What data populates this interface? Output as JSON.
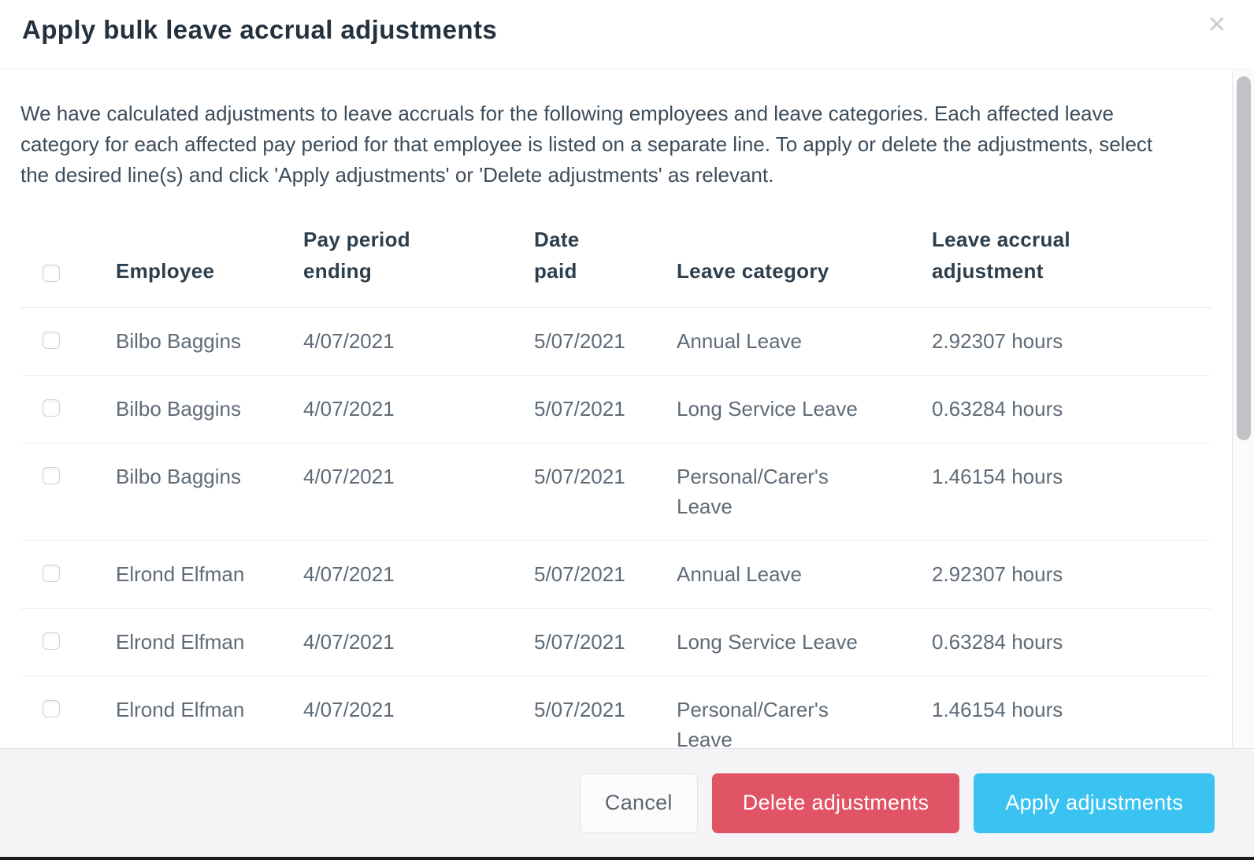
{
  "modal": {
    "title": "Apply bulk leave accrual adjustments",
    "close_icon": "×",
    "description": "We have calculated adjustments to leave accruals for the following employees and leave categories. Each affected leave category for each affected pay period for that employee is listed on a separate line. To apply or delete the adjustments, select the desired line(s) and click 'Apply adjustments' or 'Delete adjustments' as relevant."
  },
  "table": {
    "columns": {
      "employee": "Employee",
      "pay_period_ending": "Pay period ending",
      "date_paid": "Date paid",
      "leave_category": "Leave category",
      "adjustment": "Leave accrual adjustment"
    },
    "select_all_checked": false,
    "rows": [
      {
        "employee": "Bilbo Baggins",
        "pay_period_ending": "4/07/2021",
        "date_paid": "5/07/2021",
        "leave_category": "Annual Leave",
        "adjustment": "2.92307 hours",
        "selected": false
      },
      {
        "employee": "Bilbo Baggins",
        "pay_period_ending": "4/07/2021",
        "date_paid": "5/07/2021",
        "leave_category": "Long Service Leave",
        "adjustment": "0.63284 hours",
        "selected": false
      },
      {
        "employee": "Bilbo Baggins",
        "pay_period_ending": "4/07/2021",
        "date_paid": "5/07/2021",
        "leave_category": "Personal/Carer's Leave",
        "adjustment": "1.46154 hours",
        "selected": false
      },
      {
        "employee": "Elrond Elfman",
        "pay_period_ending": "4/07/2021",
        "date_paid": "5/07/2021",
        "leave_category": "Annual Leave",
        "adjustment": "2.92307 hours",
        "selected": false
      },
      {
        "employee": "Elrond Elfman",
        "pay_period_ending": "4/07/2021",
        "date_paid": "5/07/2021",
        "leave_category": "Long Service Leave",
        "adjustment": "0.63284 hours",
        "selected": false
      },
      {
        "employee": "Elrond Elfman",
        "pay_period_ending": "4/07/2021",
        "date_paid": "5/07/2021",
        "leave_category": "Personal/Carer's Leave",
        "adjustment": "1.46154 hours",
        "selected": false
      }
    ]
  },
  "footer": {
    "cancel_label": "Cancel",
    "delete_label": "Delete adjustments",
    "apply_label": "Apply adjustments"
  },
  "colors": {
    "title_text": "#24323f",
    "body_text": "#5f6b77",
    "delete_button": "#e05466",
    "apply_button": "#3ac3f1",
    "cancel_text": "#5d6772",
    "footer_background": "#f4f4f6"
  }
}
